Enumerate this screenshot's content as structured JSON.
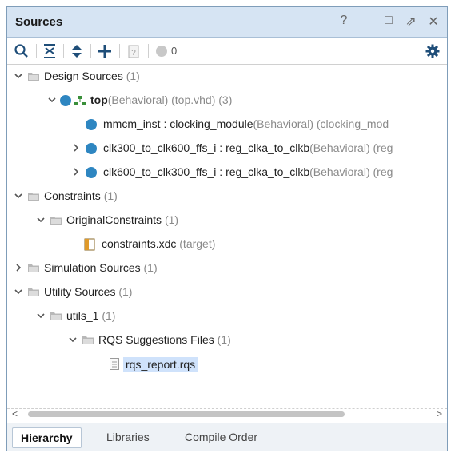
{
  "panel": {
    "title": "Sources"
  },
  "window_controls": {
    "help": "?",
    "minimize": "_",
    "restore": "□",
    "float": "⇗",
    "close": "✕"
  },
  "toolbar": {
    "badge_count": "0"
  },
  "tree": [
    {
      "id": "design-sources",
      "name": "Design Sources",
      "count": " (1)",
      "expanded": true
    },
    {
      "id": "top",
      "name": "top",
      "suffix": "(Behavioral) (top.vhd) (3)",
      "expanded": true
    },
    {
      "id": "mmcm",
      "name": "mmcm_inst : clocking_module",
      "suffix": "(Behavioral) (clocking_mod"
    },
    {
      "id": "clk300",
      "name": "clk300_to_clk600_ffs_i : reg_clka_to_clkb",
      "suffix": "(Behavioral) (reg"
    },
    {
      "id": "clk600",
      "name": "clk600_to_clk300_ffs_i : reg_clka_to_clkb",
      "suffix": "(Behavioral) (reg"
    },
    {
      "id": "constraints",
      "name": "Constraints",
      "count": " (1)"
    },
    {
      "id": "original-constraints",
      "name": "OriginalConstraints",
      "count": " (1)"
    },
    {
      "id": "constraints-xdc",
      "name": "constraints.xdc",
      "suffix": " (target)"
    },
    {
      "id": "simulation-sources",
      "name": "Simulation Sources",
      "count": " (1)"
    },
    {
      "id": "utility-sources",
      "name": "Utility Sources",
      "count": " (1)"
    },
    {
      "id": "utils-1",
      "name": "utils_1",
      "count": " (1)"
    },
    {
      "id": "rqs-suggestions",
      "name": "RQS Suggestions Files",
      "count": " (1)"
    },
    {
      "id": "rqs-report",
      "name": "rqs_report.rqs"
    }
  ],
  "tabs": [
    "Hierarchy",
    "Libraries",
    "Compile Order"
  ],
  "colors": {
    "accent": "#2e86c1",
    "title_bg": "#d6e4f3",
    "selection": "#cfe2fb"
  }
}
